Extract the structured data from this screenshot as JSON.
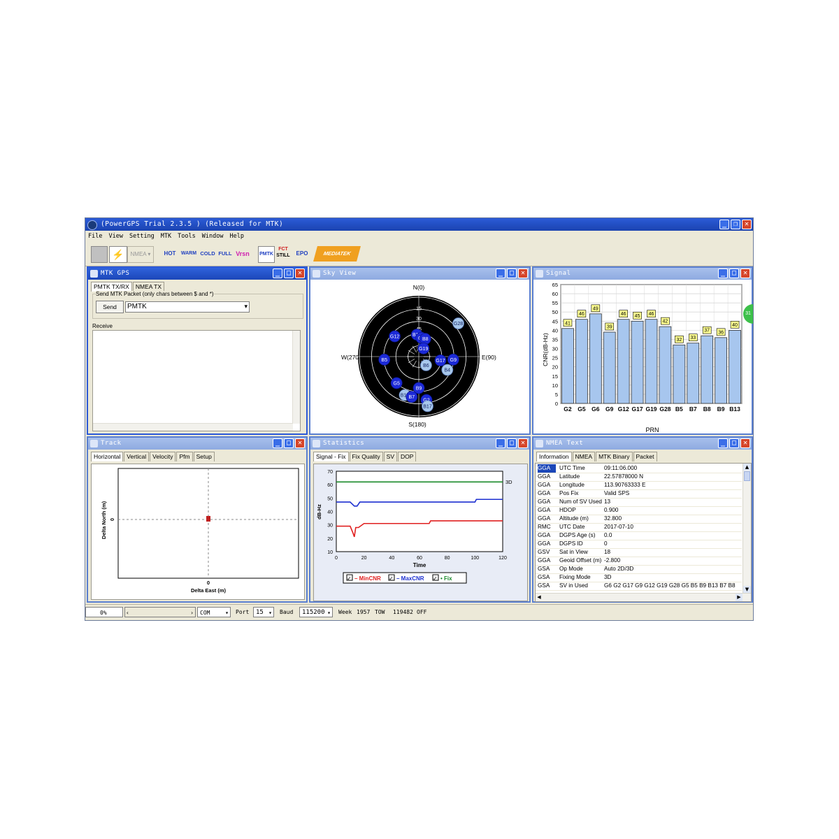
{
  "app": {
    "title": "(PowerGPS Trial 2.3.5 ) (Released for MTK)"
  },
  "menu": [
    "File",
    "View",
    "Setting",
    "MTK",
    "Tools",
    "Window",
    "Help"
  ],
  "toolbar": {
    "nmea_label": "NMEA",
    "hot": "HOT",
    "warm": "WARM",
    "cold": "COLD",
    "full": "FULL",
    "vrsn": "Vrsn",
    "pmtk": "PMTK",
    "fct_line1": "FCT",
    "fct_line2": "STILL",
    "epo": "EPO",
    "brand": "MEDIATEK"
  },
  "mtk_gps": {
    "title": "MTK GPS",
    "tabs": [
      "PMTK TX/RX",
      "NMEA TX"
    ],
    "send_group": "Send MTK Packet (only chars between $ and *)",
    "send_button": "Send",
    "packet_value": "PMTK",
    "receive_label": "Receive"
  },
  "sky_view": {
    "title": "Sky View",
    "north": "N(0)",
    "south": "S(180)",
    "east": "E(90)",
    "west": "W(270)",
    "ring_labels": [
      "15",
      "30",
      "45",
      "60",
      "75"
    ],
    "satellites": [
      {
        "id": "G12",
        "az": 310,
        "el": 40,
        "kind": "gps-used"
      },
      {
        "id": "B13",
        "az": 355,
        "el": 55,
        "kind": "gps-used"
      },
      {
        "id": "G6",
        "az": 8,
        "el": 60,
        "kind": "gps-used"
      },
      {
        "id": "B8",
        "az": 20,
        "el": 60,
        "kind": "gps-used"
      },
      {
        "id": "G28",
        "az": 50,
        "el": 8,
        "kind": "light"
      },
      {
        "id": "G19",
        "az": 30,
        "el": 75,
        "kind": "gps-used"
      },
      {
        "id": "G17",
        "az": 100,
        "el": 55,
        "kind": "gps-used"
      },
      {
        "id": "G9",
        "az": 95,
        "el": 35,
        "kind": "gps-used"
      },
      {
        "id": "B6",
        "az": 140,
        "el": 72,
        "kind": "light"
      },
      {
        "id": "B4",
        "az": 115,
        "el": 40,
        "kind": "light"
      },
      {
        "id": "B5",
        "az": 265,
        "el": 35,
        "kind": "gps-used"
      },
      {
        "id": "G5",
        "az": 220,
        "el": 35,
        "kind": "gps-used"
      },
      {
        "id": "B9",
        "az": 180,
        "el": 40,
        "kind": "gps-used"
      },
      {
        "id": "B10",
        "az": 200,
        "el": 25,
        "kind": "light"
      },
      {
        "id": "B7",
        "az": 190,
        "el": 25,
        "kind": "gps-used"
      },
      {
        "id": "G2",
        "az": 170,
        "el": 20,
        "kind": "gps-used"
      },
      {
        "id": "B17",
        "az": 170,
        "el": 10,
        "kind": "light"
      }
    ]
  },
  "signal": {
    "title": "Signal",
    "ylabel": "CNR(dB-Hz)",
    "xlabel": "PRN",
    "badge": "31"
  },
  "chart_data": [
    {
      "type": "bar",
      "title": "Signal",
      "categories": [
        "G2",
        "G5",
        "G6",
        "G9",
        "G12",
        "G17",
        "G19",
        "G28",
        "B5",
        "B7",
        "B8",
        "B9",
        "B13"
      ],
      "values": [
        41,
        46,
        49,
        39,
        46,
        45,
        46,
        42,
        32,
        33,
        37,
        36,
        40
      ],
      "xlabel": "PRN",
      "ylabel": "CNR(dB-Hz)",
      "ylim": [
        0,
        65
      ],
      "yticks": [
        0,
        5,
        10,
        15,
        20,
        25,
        30,
        35,
        40,
        45,
        50,
        55,
        60,
        65
      ],
      "bar_color": "#a7c6ee",
      "grid": true
    },
    {
      "type": "line",
      "title": "",
      "xlabel": "Time",
      "ylabel": "dB-Hz",
      "xlim": [
        0,
        120
      ],
      "ylim": [
        10,
        70
      ],
      "xticks": [
        0,
        20,
        40,
        60,
        80,
        100,
        120
      ],
      "yticks": [
        10,
        20,
        30,
        40,
        50,
        60,
        70
      ],
      "right_label": "3D",
      "legend_position": "bottom",
      "series": [
        {
          "name": "MinCNR",
          "color": "#e02020",
          "x": [
            0,
            10,
            12,
            13,
            14,
            16,
            20,
            67,
            68,
            120
          ],
          "y": [
            29,
            29,
            24,
            21,
            28,
            28,
            31,
            31,
            33,
            33
          ]
        },
        {
          "name": "MaxCNR",
          "color": "#1c2fd0",
          "x": [
            0,
            10,
            13,
            15,
            17,
            20,
            100,
            101,
            120
          ],
          "y": [
            47,
            47,
            44,
            44,
            47,
            47,
            47,
            49,
            49
          ]
        },
        {
          "name": "Fix",
          "color": "#1a8a2a",
          "x": [
            0,
            120
          ],
          "y": [
            62,
            62
          ]
        }
      ]
    }
  ],
  "track": {
    "title": "Track",
    "tabs": [
      "Horizontal",
      "Vertical",
      "Velocity",
      "Pfm",
      "Setup"
    ],
    "ylabel": "Delta North (m)",
    "xlabel": "Delta East (m)",
    "zero": "0"
  },
  "statistics": {
    "title": "Statistics",
    "tabs": [
      "Signal - Fix",
      "Fix Quality",
      "SV",
      "DOP"
    ],
    "legend": [
      "MinCNR",
      "MaxCNR",
      "Fix"
    ]
  },
  "nmea_text": {
    "title": "NMEA Text",
    "tabs": [
      "Information",
      "NMEA",
      "MTK Binary",
      "Packet"
    ],
    "rows": [
      {
        "src": "GGA",
        "field": "UTC Time",
        "value": "09:11:06.000"
      },
      {
        "src": "GGA",
        "field": "Latitude",
        "value": "22.57878000 N"
      },
      {
        "src": "GGA",
        "field": "Longitude",
        "value": "113.90763333 E"
      },
      {
        "src": "GGA",
        "field": "Pos Fix",
        "value": "Valid SPS"
      },
      {
        "src": "GGA",
        "field": "Num of SV Used",
        "value": "13"
      },
      {
        "src": "GGA",
        "field": "HDOP",
        "value": "0.900"
      },
      {
        "src": "GGA",
        "field": "Altitude (m)",
        "value": "32.800"
      },
      {
        "src": "RMC",
        "field": "UTC Date",
        "value": "2017-07-10"
      },
      {
        "src": "GGA",
        "field": "DGPS Age (s)",
        "value": "0.0"
      },
      {
        "src": "GGA",
        "field": "DGPS ID",
        "value": "0"
      },
      {
        "src": "GSV",
        "field": "Sat in View",
        "value": "18"
      },
      {
        "src": "GGA",
        "field": "Geoid Offset (m)",
        "value": "-2.800"
      },
      {
        "src": "GSA",
        "field": "Op Mode",
        "value": "Auto 2D/3D"
      },
      {
        "src": "GSA",
        "field": "Fixing Mode",
        "value": "3D"
      },
      {
        "src": "GSA",
        "field": "SV in Used",
        "value": "G6 G2 G17 G9 G12 G19 G28 G5 B5 B9 B13 B7 B8"
      }
    ]
  },
  "status": {
    "progress": "0%",
    "progress_fraction": 0,
    "com": "COM",
    "port_label": "Port",
    "port_value": "15",
    "baud_label": "Baud",
    "baud_value": "115200",
    "week_label": "Week",
    "week_value": "1957",
    "tow_label": "TOW",
    "tow_value": "119482",
    "state": "OFF"
  }
}
